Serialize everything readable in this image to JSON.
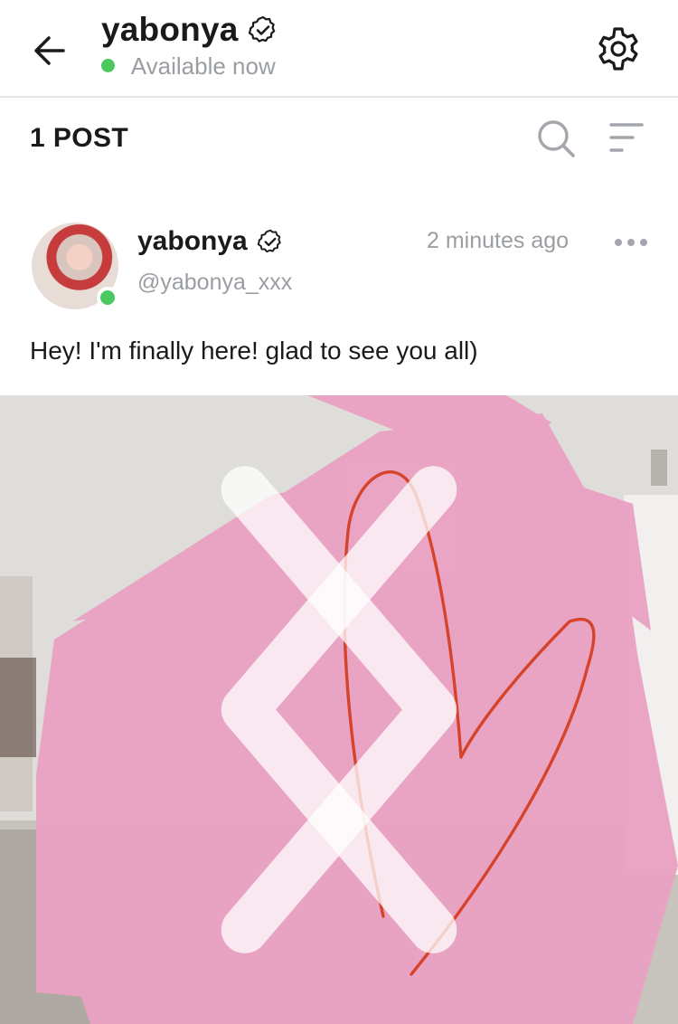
{
  "header": {
    "username": "yabonya",
    "status": "Available now",
    "status_color": "#49c95e"
  },
  "toolbar": {
    "post_count_label": "1 POST"
  },
  "post": {
    "author_name": "yabonya",
    "author_handle": "@yabonya_xxx",
    "timestamp": "2 minutes ago",
    "caption": "Hey! I'm finally here! glad to see you all)"
  },
  "icons": {
    "back": "arrow-left-icon",
    "verified": "verified-badge-icon",
    "settings": "gear-icon",
    "search": "search-icon",
    "sort": "sort-icon",
    "more": "more-horizontal-icon",
    "prev": "chevron-left-icon",
    "next": "chevron-right-icon"
  },
  "colors": {
    "accent_online": "#49c95e",
    "text_muted": "#9a9ea3",
    "censor_pink": "#eaa2c4",
    "heart_stroke": "#d6432b"
  }
}
